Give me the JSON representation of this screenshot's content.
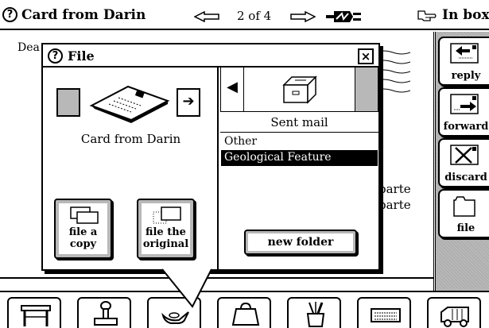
{
  "topbar": {
    "help_icon": "question-mark-circle-icon",
    "card_title": "Card from Darin",
    "prev_icon": "left-arrow-icon",
    "page_counter": "2 of 4",
    "next_icon": "right-arrow-icon",
    "connection_icon": "plug-icon",
    "pointer_icon": "pointing-hand-icon",
    "location_label": "In box"
  },
  "letter": {
    "greeting_fragment": "Dea",
    "body_fragments": [
      "parte",
      "parte"
    ]
  },
  "actions": [
    {
      "id": "reply",
      "label": "reply",
      "icon": "reply-envelope-icon"
    },
    {
      "id": "forward",
      "label": "forward",
      "icon": "forward-envelope-icon"
    },
    {
      "id": "discard",
      "label": "discard",
      "icon": "discard-envelope-icon"
    },
    {
      "id": "file",
      "label": "file",
      "icon": "folder-icon"
    }
  ],
  "dock": [
    {
      "id": "desk",
      "icon": "desk-icon"
    },
    {
      "id": "stamp",
      "icon": "rubber-stamp-icon"
    },
    {
      "id": "lamp",
      "icon": "magic-lamp-icon"
    },
    {
      "id": "bag",
      "icon": "purse-icon"
    },
    {
      "id": "tools",
      "icon": "tool-cup-icon"
    },
    {
      "id": "keyboard",
      "icon": "keyboard-icon"
    },
    {
      "id": "truck",
      "icon": "delivery-truck-icon"
    }
  ],
  "file_dialog": {
    "help_icon": "question-mark-circle-icon",
    "title": "File",
    "close_glyph": "×",
    "item_caption": "Card from Darin",
    "item_icon": "postcard-icon",
    "file_copy_label": "file a copy",
    "file_original_label": "file the original",
    "folder_icon": "file-cabinet-icon",
    "current_folder": "Sent mail",
    "folders": [
      {
        "name": "Other",
        "selected": false
      },
      {
        "name": "Geological Feature",
        "selected": true
      }
    ],
    "new_folder_label": "new folder"
  }
}
